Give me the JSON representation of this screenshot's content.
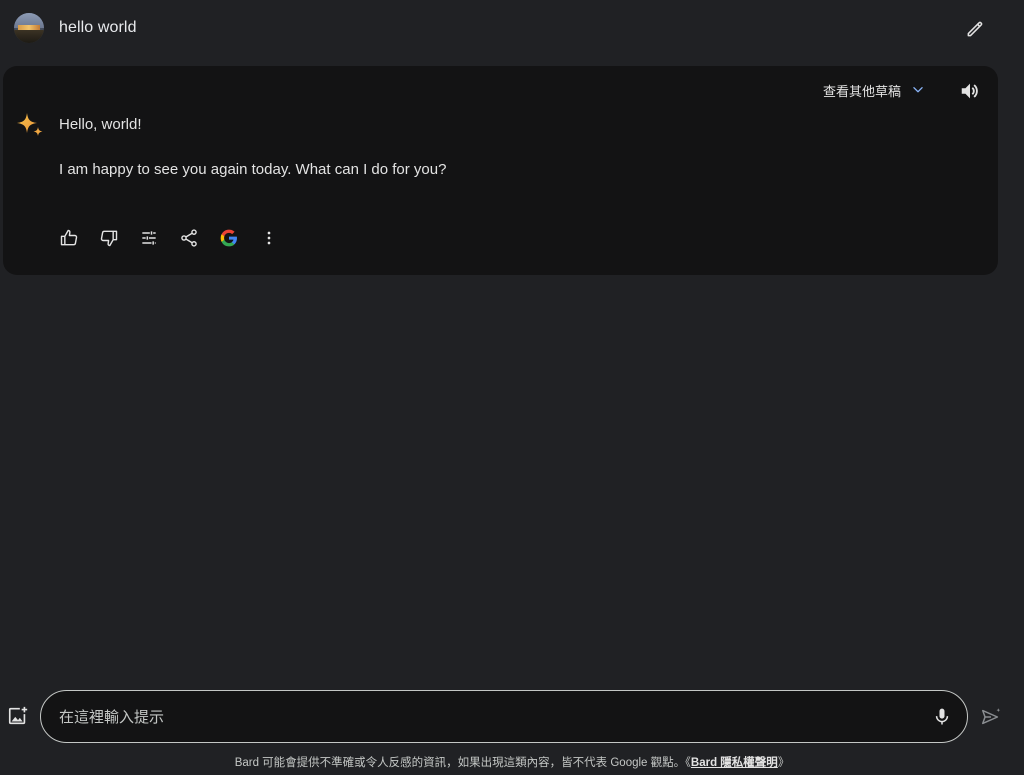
{
  "prompt": {
    "text": "hello world"
  },
  "response": {
    "drafts_label": "查看其他草稿",
    "line1": "Hello, world!",
    "line2": "I am happy to see you again today. What can I do for you?",
    "actions": [
      "thumbs-up-icon",
      "thumbs-down-icon",
      "tune-icon",
      "share-icon",
      "google-icon",
      "more-vert-icon"
    ]
  },
  "input": {
    "placeholder": "在這裡輸入提示"
  },
  "footer": {
    "disclaimer": "Bard 可能會提供不準確或令人反感的資訊，如果出現這類內容，皆不代表 Google 觀點。《",
    "privacy_link": "Bard 隱私權聲明",
    "closing": "》"
  },
  "colors": {
    "background": "#202124",
    "card": "#131314",
    "text": "#e3e3e3",
    "google_blue": "#4285f4",
    "google_red": "#ea4335",
    "google_yellow": "#fbbc04",
    "google_green": "#34a853"
  }
}
